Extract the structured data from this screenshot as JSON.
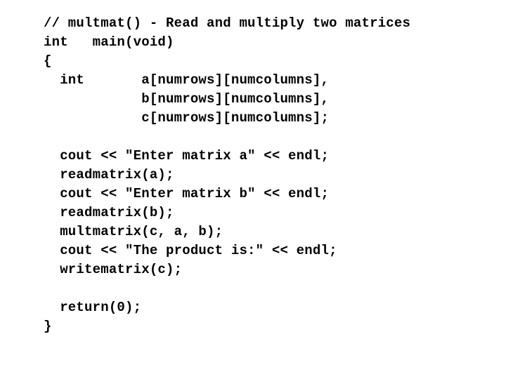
{
  "code": {
    "lines": [
      "// multmat() - Read and multiply two matrices",
      "int   main(void)",
      "{",
      "  int       a[numrows][numcolumns],",
      "            b[numrows][numcolumns],",
      "            c[numrows][numcolumns];",
      "",
      "  cout << \"Enter matrix a\" << endl;",
      "  readmatrix(a);",
      "  cout << \"Enter matrix b\" << endl;",
      "  readmatrix(b);",
      "  multmatrix(c, a, b);",
      "  cout << \"The product is:\" << endl;",
      "  writematrix(c);",
      "",
      "  return(0);",
      "}"
    ]
  }
}
